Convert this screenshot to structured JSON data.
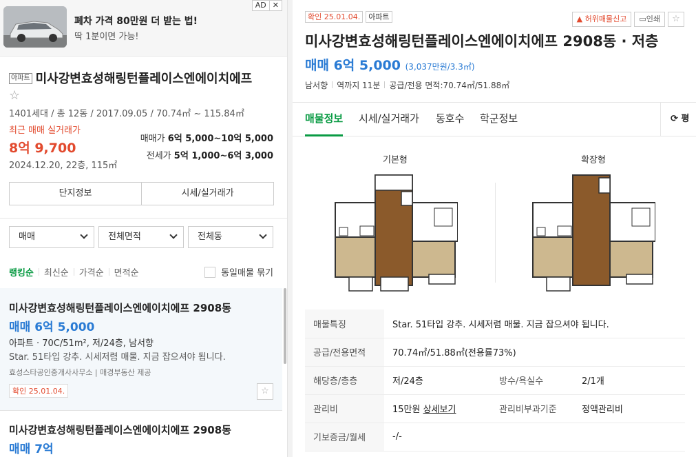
{
  "ad": {
    "title": "폐차 가격 80만원 더 받는 법!",
    "subtitle": "딱 1분이면 가능!",
    "tag": "AD",
    "close": "✕"
  },
  "complex": {
    "type": "아파트",
    "name": "미사강변효성해링턴플레이스엔에이치에프",
    "star": "☆",
    "info": "1401세대 / 총 12동 / 2017.09.05 / 70.74㎡ ~ 115.84㎡",
    "recent_label": "최근 매매 실거래가",
    "recent_price": "8억 9,700",
    "recent_date": "2024.12.20, 22층, 115㎡",
    "sale_label": "매매가",
    "sale_range": "6억 5,000~10억 5,000",
    "jeonse_label": "전세가",
    "jeonse_range": "5억 1,000~6억 3,000",
    "buttons": [
      "단지정보",
      "시세/실거래가"
    ]
  },
  "filters": [
    "매매",
    "전체면적",
    "전체동"
  ],
  "sorts": [
    "랭킹순",
    "최신순",
    "가격순",
    "면적순"
  ],
  "same_listing": "동일매물 묶기",
  "listings": [
    {
      "name": "미사강변효성해링턴플레이스엔에이치에프 2908동",
      "price": "매매 6억 5,000",
      "spec": "아파트 · 70C/51m², 저/24층, 남서향",
      "desc": "Star. 51타입 강추. 시세저렴 매물. 지금 잡으셔야 됩니다.",
      "agent": "효성스타공인중개사사무소 | 매경부동산 제공",
      "confirm": "확인 25.01.04.",
      "fav": "☆"
    },
    {
      "name": "미사강변효성해링턴플레이스엔에이치에프 2908동",
      "price": "매매 7억"
    }
  ],
  "detail": {
    "confirm": "확인 25.01.04.",
    "type": "아파트",
    "report": "허위매물신고",
    "print": "인쇄",
    "star": "☆",
    "title": "미사강변효성해링턴플레이스엔에이치에프 2908동 · 저층",
    "price": "매매 6억 5,000",
    "price_per": "(3,037만원/3.3㎡)",
    "info": [
      "남서향",
      "역까지 11분",
      "공급/전용 면적:70.74㎡/51.88㎡"
    ],
    "tabs": [
      "매물정보",
      "시세/실거래가",
      "동호수",
      "학군정보"
    ],
    "pyeong": "⟳ 평",
    "plan_labels": [
      "기본형",
      "확장형"
    ],
    "table": {
      "feature_label": "매물특징",
      "feature": "Star. 51타입 강추. 시세저렴 매물. 지금 잡으셔야 됩니다.",
      "area_label": "공급/전용면적",
      "area": "70.74㎡/51.88㎡(전용률73%)",
      "floor_label": "해당층/총층",
      "floor": "저/24층",
      "rooms_label": "방수/욕실수",
      "rooms": "2/1개",
      "fee_label": "관리비",
      "fee": "15만원",
      "fee_link": "상세보기",
      "fee_basis_label": "관리비부과기준",
      "fee_basis": "정액관리비",
      "deposit_label": "기보증금/월세",
      "deposit": "-/-"
    }
  },
  "colors": {
    "green": "#0a9b44",
    "blue": "#2a7bd4",
    "red": "#e24a2e"
  }
}
